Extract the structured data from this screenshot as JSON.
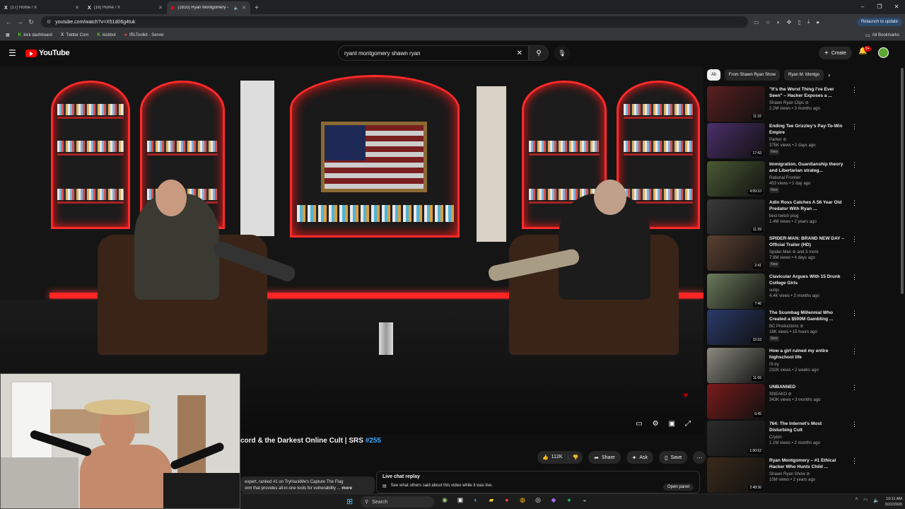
{
  "browser": {
    "tabs": [
      {
        "icon": "X",
        "title": "(17) Home / X",
        "active": false
      },
      {
        "icon": "X",
        "title": "(18) Home / X",
        "active": false
      },
      {
        "icon": "▶",
        "title": "(1810) Ryan Montgomery - ",
        "active": true
      }
    ],
    "new_tab": "+",
    "window_controls": [
      "–",
      "❐",
      "✕"
    ],
    "url": "youtube.com/watch?v=X51d06g4tuk",
    "relaunch": "Relaunch to update",
    "bookmarks": [
      {
        "icon": "kick",
        "label": "kick dashboard"
      },
      {
        "icon": "x",
        "label": "Twitter Com"
      },
      {
        "icon": "kick",
        "label": "kickbot"
      },
      {
        "icon": "irl",
        "label": "IRLToolkit - Server"
      }
    ],
    "all_bookmarks": "All Bookmarks"
  },
  "youtube": {
    "logo_text": "YouTube",
    "search_query": "ryant montgomery shawn ryan",
    "create_label": "Create",
    "notif_badge": "9+"
  },
  "video": {
    "title_main": "cord & the Darkest Online Cult | SRS ",
    "title_tag": "#255",
    "likes": "112K",
    "share": "Share",
    "ask": "Ask",
    "save": "Save",
    "description": "expert, ranked #1 on TryHackMe's Capture The Flag",
    "description2": "orm that provides all-in-one tools for vulnerability ...",
    "description_more": "more",
    "live_chat_title": "Live chat replay",
    "live_chat_sub": "See what others said about this video while it was live.",
    "open_panel": "Open panel"
  },
  "sidebar": {
    "chips": [
      "All",
      "From Shawn Ryan Show",
      "Ryan M. Montgo"
    ],
    "recommendations": [
      {
        "title": "\"It's the Worst Thing I've Ever Seen\" – Hacker Exposes a ...",
        "channel": "Shawn Ryan Clips ⊘",
        "meta": "2.2M views • 3 months ago",
        "badge": "",
        "duration": "11:32",
        "color": "#5a1f1f"
      },
      {
        "title": "Ending Tee Grizzley's Pay-To-Win Empire",
        "channel": "Parker ⊘",
        "meta": "375K views • 2 days ago",
        "badge": "New",
        "duration": "17:43",
        "color": "#4b2f6b"
      },
      {
        "title": "Immigration, Guardianship theory and Libertarian strateg...",
        "channel": "Rational Frontier",
        "meta": "403 views • 1 day ago",
        "badge": "New",
        "duration": "4:09:10",
        "color": "#4a5a34"
      },
      {
        "title": "Adin Ross Catches A 56 Year Old Predator With Ryan ...",
        "channel": "best twitch plug",
        "meta": "1.4M views • 2 years ago",
        "badge": "",
        "duration": "11:39",
        "color": "#3a3a3a"
      },
      {
        "title": "SPIDER-MAN: BRAND NEW DAY – Official Trailer (HD)",
        "channel": "Spider-Man ⊘ and 3 more",
        "meta": "7.9M views • 4 days ago",
        "badge": "New",
        "duration": "2:41",
        "color": "#5a4030"
      },
      {
        "title": "Clavicular Argues With 15 Drunk College Girls",
        "channel": "sulqs",
        "meta": "4.4K views • 3 months ago",
        "badge": "",
        "duration": "7:46",
        "color": "#6a7a5a"
      },
      {
        "title": "The Scumbag Millennial Who Created a $500M Gambling ...",
        "channel": "BC Productions ⊘",
        "meta": "16K views • 15 hours ago",
        "badge": "New",
        "duration": "15:53",
        "color": "#2a3a6a"
      },
      {
        "title": "How a girl ruined my entire highschool life",
        "channel": "I'll try",
        "meta": "232K views • 2 weeks ago",
        "badge": "",
        "duration": "11:06",
        "color": "#8a8a80"
      },
      {
        "title": "UNBANNED",
        "channel": "SNEAKO ⊘",
        "meta": "343K views • 3 months ago",
        "badge": "",
        "duration": "6:45",
        "color": "#7a1a1a"
      },
      {
        "title": "764: The Internet's Most Disturbing Cult",
        "channel": "Cryton",
        "meta": "1.1M views • 2 months ago",
        "badge": "",
        "duration": "1:00:52",
        "color": "#2a2a2a"
      },
      {
        "title": "Ryan Montgomery – #1 Ethical Hacker Who Hunts Child ...",
        "channel": "Shawn Ryan Show ⊘",
        "meta": "10M views • 2 years ago",
        "badge": "",
        "duration": "2:48:36",
        "color": "#3a2a1a"
      }
    ]
  },
  "taskbar": {
    "search": "Search",
    "time": "10:11 AM",
    "date": "3/22/2026"
  }
}
